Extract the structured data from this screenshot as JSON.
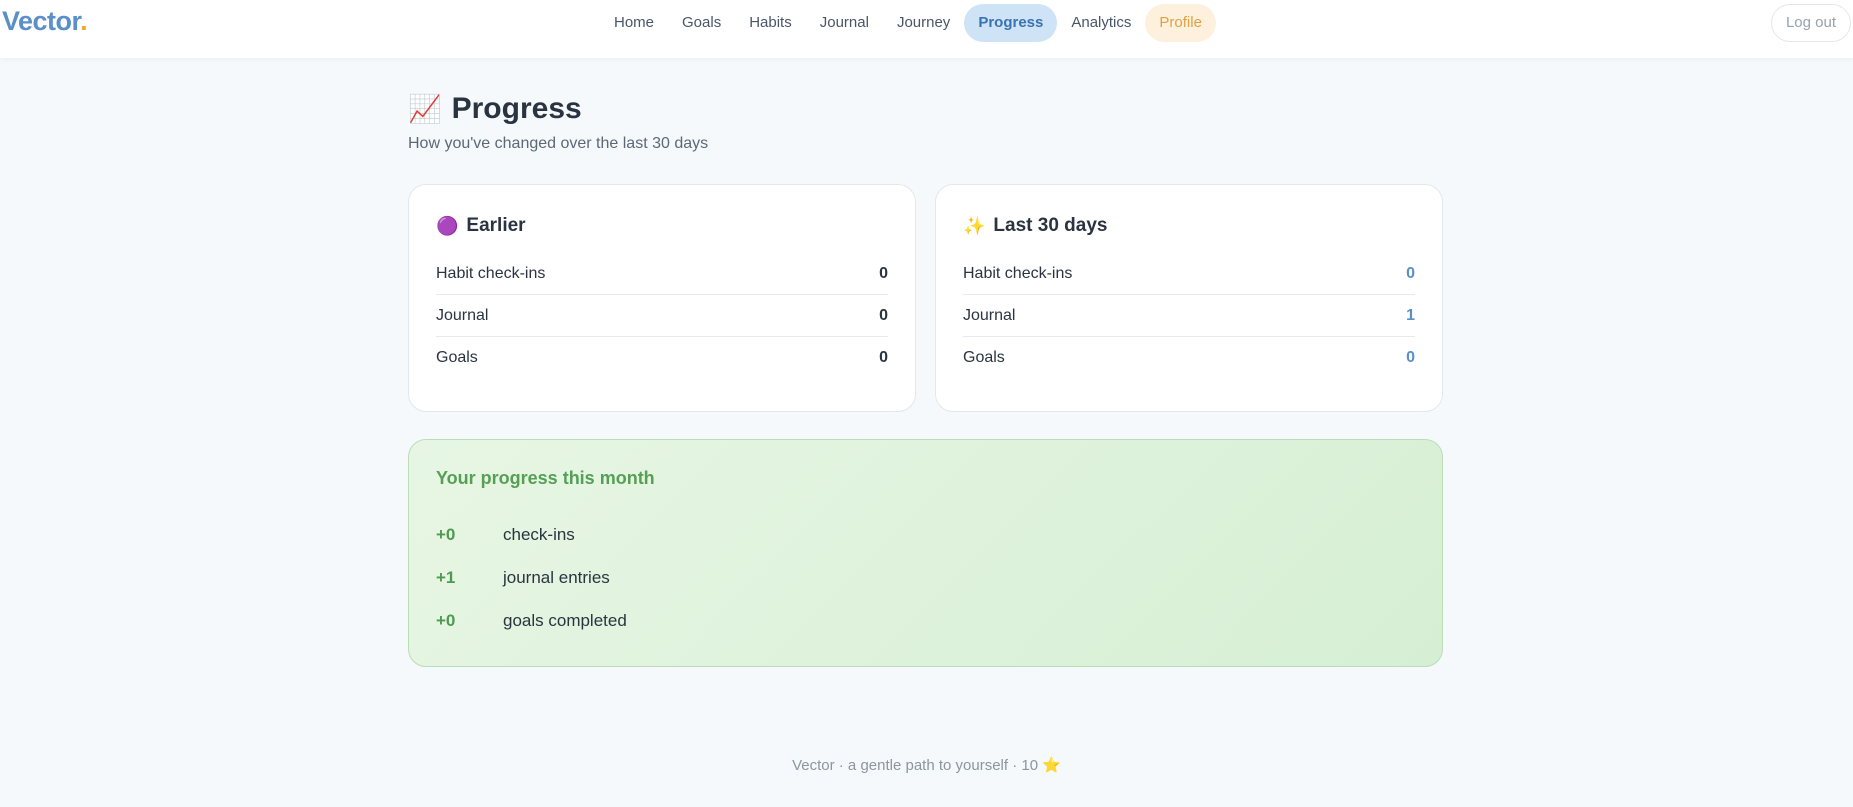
{
  "app": {
    "logo_text": "Vector",
    "logo_dot": "."
  },
  "nav": {
    "items": [
      {
        "label": "Home"
      },
      {
        "label": "Goals"
      },
      {
        "label": "Habits"
      },
      {
        "label": "Journal"
      },
      {
        "label": "Journey"
      },
      {
        "label": "Progress",
        "active": true
      },
      {
        "label": "Analytics"
      },
      {
        "label": "Profile"
      }
    ],
    "logout_label": "Log out"
  },
  "page": {
    "emoji": "📈",
    "title": "Progress",
    "subtitle": "How you've changed over the last 30 days"
  },
  "earlier": {
    "emoji": "🟣",
    "title": "Earlier",
    "rows": [
      {
        "label": "Habit check-ins",
        "value": "0"
      },
      {
        "label": "Journal",
        "value": "0"
      },
      {
        "label": "Goals",
        "value": "0"
      }
    ]
  },
  "recent": {
    "emoji": "✨",
    "title": "Last 30 days",
    "rows": [
      {
        "label": "Habit check-ins",
        "value": "0"
      },
      {
        "label": "Journal",
        "value": "1"
      },
      {
        "label": "Goals",
        "value": "0"
      }
    ]
  },
  "month": {
    "title": "Your progress this month",
    "rows": [
      {
        "delta": "+0",
        "label": "check-ins"
      },
      {
        "delta": "+1",
        "label": "journal entries"
      },
      {
        "delta": "+0",
        "label": "goals completed"
      }
    ]
  },
  "footer": {
    "text": "Vector · a gentle path to yourself · 10 ⭐"
  },
  "colors": {
    "accent": "#5b8fc7",
    "logo_dot": "#f0a830",
    "active_nav_bg": "#cfe3f7",
    "profile_bg": "#fdf1dd",
    "success": "#4f9a4f",
    "success_bg": "#d6efd4"
  }
}
